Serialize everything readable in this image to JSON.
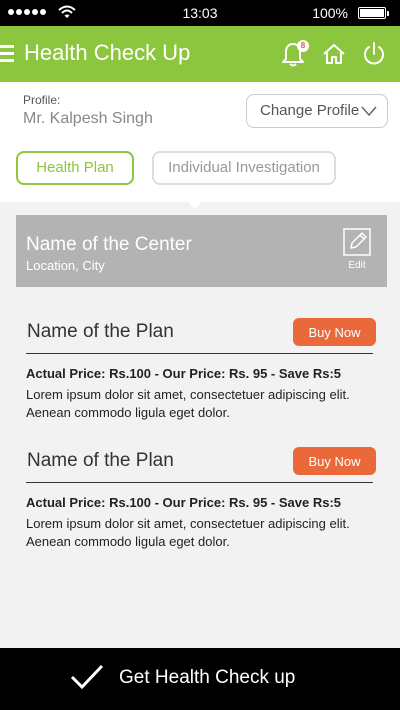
{
  "status_bar": {
    "time": "13:03",
    "battery": "100%",
    "icons": [
      "signal-dots-icon",
      "wifi-icon",
      "battery-icon"
    ]
  },
  "header": {
    "title": "Health Check Up",
    "notification_count": "8",
    "icons": [
      "menu-icon",
      "bell-icon",
      "home-icon",
      "power-icon"
    ],
    "accent_color": "#8cc63f"
  },
  "profile": {
    "label": "Profile:",
    "name": "Mr. Kalpesh Singh",
    "change_button": "Change Profile"
  },
  "tabs": [
    {
      "label": "Health Plan",
      "active": true
    },
    {
      "label": "Individual Investigation",
      "active": false
    }
  ],
  "center": {
    "name": "Name of the Center",
    "location": "Location, City",
    "edit_label": "Edit"
  },
  "plans": [
    {
      "name": "Name of the Plan",
      "buy_label": "Buy Now",
      "price_line": "Actual Price: Rs.100  -  Our Price: Rs. 95  -  Save Rs:5",
      "description": "Lorem ipsum dolor sit amet, consectetuer adipiscing elit. Aenean commodo ligula eget dolor."
    },
    {
      "name": "Name of the Plan",
      "buy_label": "Buy Now",
      "price_line": "Actual Price: Rs.100  -  Our Price: Rs. 95  -  Save Rs:5",
      "description": "Lorem ipsum dolor sit amet, consectetuer adipiscing elit. Aenean commodo ligula eget dolor."
    }
  ],
  "bottom_bar": {
    "label": "Get Health Check up"
  },
  "colors": {
    "accent": "#8cc63f",
    "buy_button": "#e9693a",
    "center_card": "#b3b3b3"
  }
}
